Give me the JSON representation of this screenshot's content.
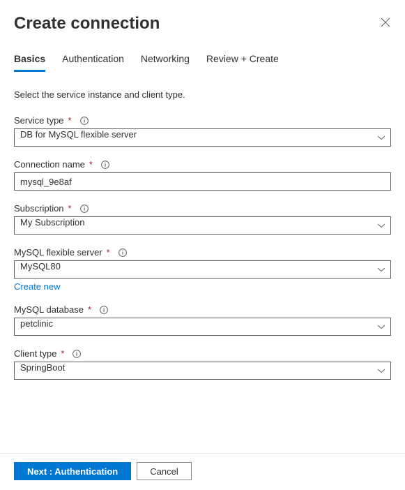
{
  "header": {
    "title": "Create connection"
  },
  "tabs": {
    "basics": "Basics",
    "authentication": "Authentication",
    "networking": "Networking",
    "review": "Review + Create"
  },
  "instruction": "Select the service instance and client type.",
  "fields": {
    "serviceType": {
      "label": "Service type",
      "value": "DB for MySQL flexible server"
    },
    "connectionName": {
      "label": "Connection name",
      "value": "mysql_9e8af"
    },
    "subscription": {
      "label": "Subscription",
      "value": "My Subscription"
    },
    "mysqlServer": {
      "label": "MySQL flexible server",
      "value": "MySQL80",
      "createNew": "Create new"
    },
    "mysqlDatabase": {
      "label": "MySQL database",
      "value": "petclinic"
    },
    "clientType": {
      "label": "Client type",
      "value": "SpringBoot"
    }
  },
  "footer": {
    "next": "Next : Authentication",
    "cancel": "Cancel"
  }
}
